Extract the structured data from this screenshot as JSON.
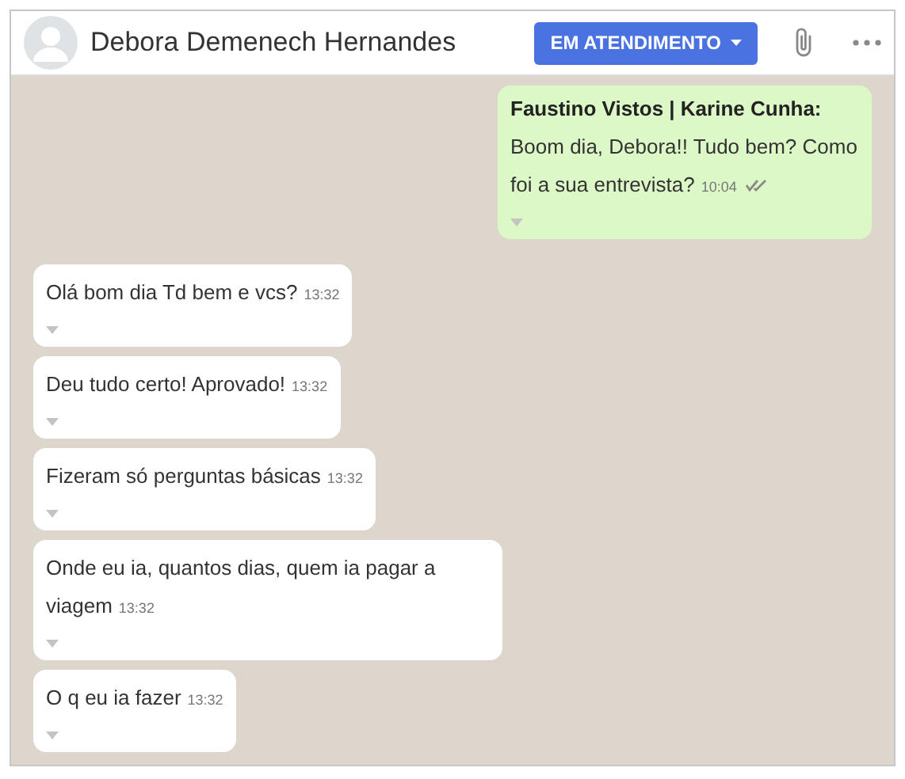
{
  "header": {
    "contact_name": "Debora Demenech Hernandes",
    "status_button": "EM ATENDIMENTO"
  },
  "messages": [
    {
      "kind": "outgoing",
      "sender": "Faustino Vistos | Karine Cunha:",
      "text": "Boom dia, Debora!! Tudo bem? Como foi a sua entrevista?",
      "time": "10:04",
      "delivered": true
    },
    {
      "kind": "incoming",
      "text": "Olá bom dia Td bem e vcs?",
      "time": "13:32"
    },
    {
      "kind": "incoming",
      "text": "Deu tudo certo! Aprovado!",
      "time": "13:32"
    },
    {
      "kind": "incoming",
      "text": "Fizeram só perguntas básicas",
      "time": "13:32"
    },
    {
      "kind": "incoming",
      "text": "Onde eu ia, quantos dias, quem ia pagar a viagem",
      "time": "13:32"
    },
    {
      "kind": "incoming",
      "text": "O q eu ia fazer",
      "time": "13:32"
    }
  ]
}
